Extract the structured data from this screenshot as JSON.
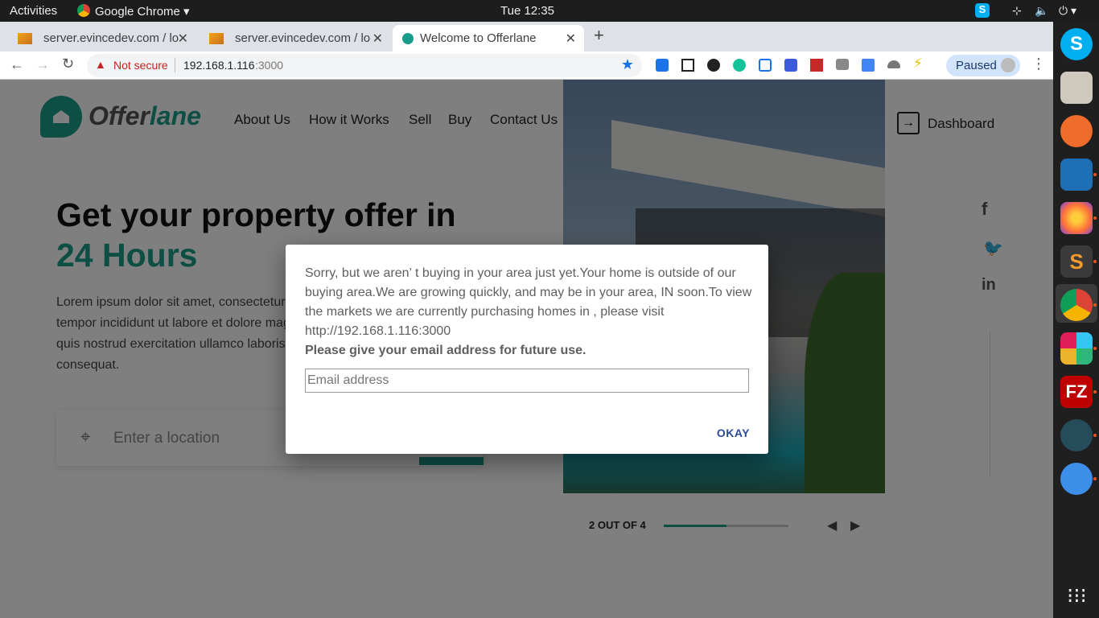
{
  "system": {
    "activities": "Activities",
    "app_name": "Google Chrome",
    "clock": "Tue 12:35"
  },
  "browser": {
    "tabs": [
      {
        "title": "server.evincedev.com / lo",
        "active": false
      },
      {
        "title": "server.evincedev.com / lo",
        "active": false
      },
      {
        "title": "Welcome to Offerlane",
        "active": true
      }
    ],
    "new_tab": "+",
    "security": "Not secure",
    "url_host": "192.168.1.116",
    "url_port": ":3000",
    "profile": "Paused"
  },
  "site": {
    "logo_prefix": "Offer",
    "logo_suffix": "lane",
    "nav": [
      "About Us",
      "How it Works",
      "Sell",
      "Buy",
      "Contact Us"
    ],
    "dashboard": "Dashboard",
    "headline_1": "Get your property offer in",
    "headline_2": "24 Hours",
    "body": "Lorem ipsum dolor sit amet, consectetur adipiscing elit, sed do eiusmod tempor incididunt ut labore et dolore magna aliqua. Ut enim ad minim veniam, quis nostrud exercitation ullamco laboris nisi ut aliquip ex ea commodo consequat.",
    "location_placeholder": "Enter a location",
    "slider_counter": "2 OUT OF 4",
    "slider_progress": 0.5,
    "social": [
      "facebook-icon",
      "twitter-icon",
      "linkedin-icon"
    ]
  },
  "dialog": {
    "message": "Sorry, but we aren’ t buying in your area just yet.Your home is outside of our buying area.We are growing quickly, and may be in your area, IN soon.To view the markets we are currently purchasing homes in , please visit http://192.168.1.116:3000",
    "prompt": "Please give your email address for future use.",
    "email_placeholder": "Email address",
    "okay": "OKAY"
  },
  "colors": {
    "brand_teal": "#1a9c8a",
    "dialog_button": "#2a4a9a"
  }
}
